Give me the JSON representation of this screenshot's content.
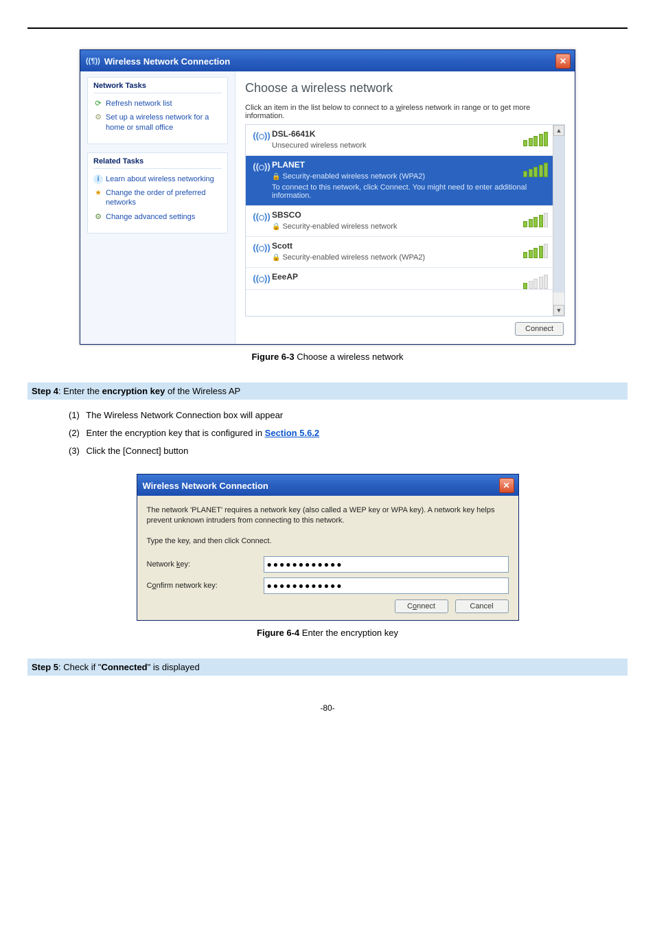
{
  "window1": {
    "title": "Wireless Network Connection",
    "sidebar": {
      "section1_header": "Network Tasks",
      "links1": [
        {
          "label": "Refresh network list"
        },
        {
          "label": "Set up a wireless network for a home or small office"
        }
      ],
      "section2_header": "Related Tasks",
      "links2": [
        {
          "label": "Learn about wireless networking"
        },
        {
          "label": "Change the order of preferred networks"
        },
        {
          "label": "Change advanced settings"
        }
      ]
    },
    "main": {
      "heading": "Choose a wireless network",
      "subtext_a": "Click an item in the list below to connect to a ",
      "subtext_w": "w",
      "subtext_b": "ireless network in range or to get more information.",
      "networks": [
        {
          "name": "DSL-6641K",
          "desc": "Unsecured wireless network",
          "lock": false,
          "selected": false,
          "signal": 5
        },
        {
          "name": "PLANET",
          "desc": "Security-enabled wireless network (WPA2)",
          "extra": "To connect to this network, click Connect. You might need to enter additional information.",
          "lock": true,
          "selected": true,
          "signal": 5
        },
        {
          "name": "SBSCO",
          "desc": "Security-enabled wireless network",
          "lock": true,
          "selected": false,
          "signal": 4
        },
        {
          "name": "Scott",
          "desc": "Security-enabled wireless network (WPA2)",
          "lock": true,
          "selected": false,
          "signal": 4
        },
        {
          "name": "EeeAP",
          "desc": "",
          "lock": false,
          "selected": false,
          "signal": 1
        }
      ],
      "connect_label": "Connect"
    }
  },
  "captions": {
    "fig1_label": "Figure 6-3",
    "fig1_text": " Choose a wireless network",
    "fig2_label": "Figure 6-4",
    "fig2_text": " Enter the encryption key"
  },
  "steps": {
    "step4_a": "Step 4",
    "step4_b": ": Enter the ",
    "step4_c": "encryption key",
    "step4_d": " of the Wireless AP",
    "sub1_n": "(1)",
    "sub1_t": "The Wireless Network Connection box will appear",
    "sub2_n": "(2)",
    "sub2_t_a": "Enter the encryption key that is configured in ",
    "sub2_link": "Section 5.6.2",
    "sub3_n": "(3)",
    "sub3_t": "Click the [Connect] button",
    "step5_a": "Step 5",
    "step5_b": ": Check if \"",
    "step5_c": "Connected",
    "step5_d": "\" is displayed"
  },
  "dialog2": {
    "title": "Wireless Network Connection",
    "body_text": "The network 'PLANET' requires a network key (also called a WEP key or WPA key). A network key helps prevent unknown intruders from connecting to this network.",
    "instruction": "Type the key, and then click Connect.",
    "label1_a": "Network ",
    "label1_u": "k",
    "label1_b": "ey:",
    "label2_a": "C",
    "label2_u": "o",
    "label2_b": "nfirm network key:",
    "value1": "●●●●●●●●●●●●",
    "value2": "●●●●●●●●●●●●",
    "btn_connect_a": "C",
    "btn_connect_u": "o",
    "btn_connect_b": "nnect",
    "btn_cancel": "Cancel"
  },
  "page_number": "-80-"
}
